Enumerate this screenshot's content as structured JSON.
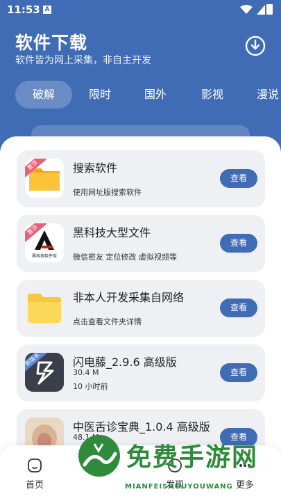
{
  "statusbar": {
    "time": "11:53",
    "sim_label": "A"
  },
  "header": {
    "title": "软件下载",
    "subtitle": "软件皆为网上采集，非自主开发",
    "download_icon": "download-circle-icon"
  },
  "tabs": [
    "破解",
    "限时",
    "国外",
    "影视",
    "漫说"
  ],
  "active_tab": "破解",
  "cards": [
    {
      "name": "搜索软件",
      "desc": "使用网址版搜索软件",
      "badge": "置顶",
      "button": "查看",
      "icon": "folder-icon"
    },
    {
      "name": "黑科技大型文件",
      "desc": "微信密友 定位修改 虚拟视频等",
      "badge": "置顶",
      "button": "查看",
      "icon": "app-logo-icon",
      "logo_text": "黑科技软件库"
    },
    {
      "name": "非本人开发采集自网络",
      "desc": "点击查看文件夹详情",
      "button": "查看",
      "icon": "folder-icon"
    },
    {
      "name": "闪电藤_2.9.6 高级版",
      "size": "30.4 M",
      "time": "10 小时前",
      "badge": "新版本",
      "button": "查看",
      "icon": "lightning-app-icon"
    },
    {
      "name": "中医舌诊宝典_1.0.4 高级版",
      "size": "48.1 M",
      "button": "查看",
      "icon": "tongue-app-icon"
    }
  ],
  "bottomnav": [
    {
      "label": "首页",
      "icon": "home-icon"
    },
    {
      "label": "发现",
      "icon": "discover-icon"
    },
    {
      "label": "更多",
      "icon": "more-icon"
    }
  ],
  "watermark": {
    "text": "免费手游网",
    "url": "MIANFEISHOUYOUWANG"
  },
  "colors": {
    "primary": "#3f6cb5",
    "card_bg": "#eff0f3",
    "ribbon": "#e5607a",
    "watermark": "#2f8a3c"
  }
}
